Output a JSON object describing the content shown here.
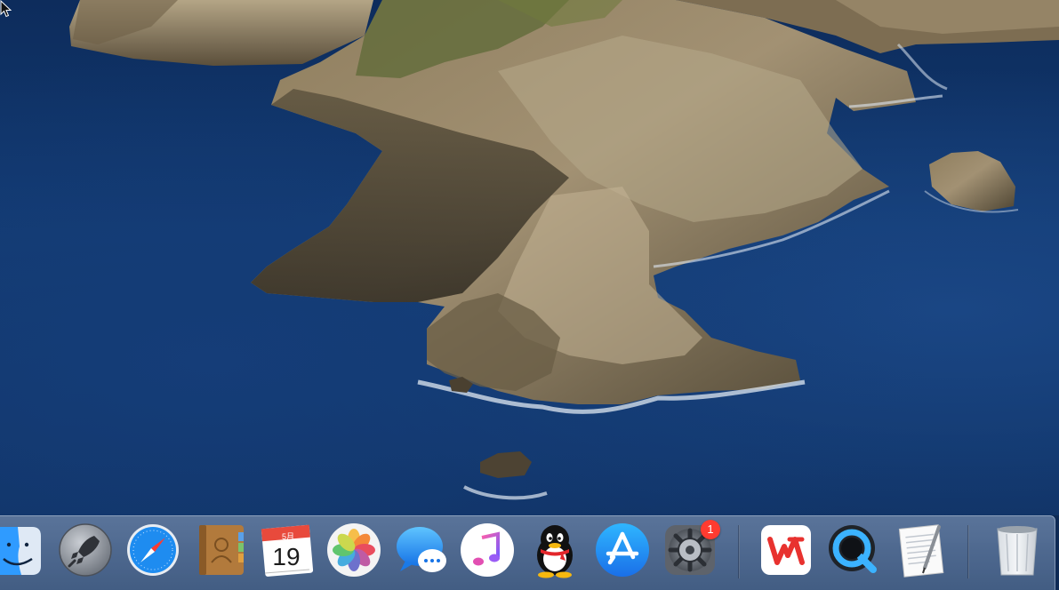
{
  "desktop": {
    "wallpaper": "catalina-island-wallpaper",
    "colors": {
      "ocean": "#133b74",
      "rock": "#8a7a5c",
      "foam": "#dfe8f2"
    }
  },
  "dock": {
    "apps": [
      {
        "id": "finder",
        "icon": "finder-icon"
      },
      {
        "id": "launchpad",
        "icon": "rocket-icon"
      },
      {
        "id": "safari",
        "icon": "compass-icon"
      },
      {
        "id": "contacts",
        "icon": "contacts-book-icon"
      },
      {
        "id": "calendar",
        "icon": "calendar-icon",
        "month": "5月",
        "day": "19"
      },
      {
        "id": "photos",
        "icon": "photos-flower-icon"
      },
      {
        "id": "messages",
        "icon": "chat-bubble-icon"
      },
      {
        "id": "music",
        "icon": "music-note-icon"
      },
      {
        "id": "qq",
        "icon": "penguin-icon"
      },
      {
        "id": "app-store",
        "icon": "app-store-icon"
      },
      {
        "id": "system-preferences",
        "icon": "gear-icon",
        "badge": "1"
      },
      {
        "id": "wps",
        "icon": "wps-icon"
      },
      {
        "id": "quicktime",
        "icon": "quicktime-icon"
      },
      {
        "id": "textedit",
        "icon": "document-pen-icon"
      },
      {
        "id": "trash",
        "icon": "trash-icon"
      }
    ],
    "colors": {
      "badge": "#ff3b30",
      "wps_red": "#e8322f",
      "appstore_blue": "#1a8cf5"
    }
  }
}
